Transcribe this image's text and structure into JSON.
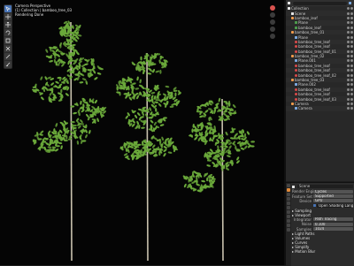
{
  "viewport": {
    "info_lines": [
      "Camera Perspective",
      "(1) Collection | bamboo_tree_03",
      "Rendering Done"
    ],
    "tools": [
      {
        "icon": "select-icon",
        "active": true
      },
      {
        "icon": "cursor-icon",
        "active": false
      },
      {
        "icon": "move-icon",
        "active": false
      },
      {
        "icon": "rotate-icon",
        "active": false
      },
      {
        "icon": "scale-icon",
        "active": false
      },
      {
        "icon": "transform-icon",
        "active": false
      },
      {
        "icon": "annotate-icon",
        "active": false
      },
      {
        "icon": "measure-icon",
        "active": false
      }
    ],
    "leaf_color": "#6aa83a",
    "stem_color": "#c9c2ae"
  },
  "outliner": {
    "rows": [
      {
        "label": "Collection",
        "indent": 0,
        "icon": "coll"
      },
      {
        "label": "Scene",
        "indent": 1,
        "icon": "coll"
      },
      {
        "label": "bamboo_leaf",
        "indent": 1,
        "icon": "obj"
      },
      {
        "label": "Plane",
        "indent": 2,
        "icon": "mesh"
      },
      {
        "label": "bamboo_leaf",
        "indent": 2,
        "icon": "mesh"
      },
      {
        "label": "bamboo_tree_01",
        "indent": 1,
        "icon": "obj"
      },
      {
        "label": "Plane",
        "indent": 2,
        "icon": "mod"
      },
      {
        "label": "bamboo_tree_leaf",
        "indent": 2,
        "icon": "part"
      },
      {
        "label": "bamboo_tree_leaf",
        "indent": 2,
        "icon": "part"
      },
      {
        "label": "bamboo_tree_leaf_01",
        "indent": 2,
        "icon": "part"
      },
      {
        "label": "bamboo_tree_02",
        "indent": 1,
        "icon": "obj"
      },
      {
        "label": "Plane.001",
        "indent": 2,
        "icon": "mod"
      },
      {
        "label": "bamboo_tree_leaf",
        "indent": 2,
        "icon": "part"
      },
      {
        "label": "bamboo_tree_leaf",
        "indent": 2,
        "icon": "part"
      },
      {
        "label": "bamboo_tree_leaf_02",
        "indent": 2,
        "icon": "part"
      },
      {
        "label": "bamboo_tree_03",
        "indent": 1,
        "icon": "obj"
      },
      {
        "label": "Plane.002",
        "indent": 2,
        "icon": "mod"
      },
      {
        "label": "bamboo_tree_leaf",
        "indent": 2,
        "icon": "part"
      },
      {
        "label": "bamboo_tree_leaf",
        "indent": 2,
        "icon": "part"
      },
      {
        "label": "bamboo_tree_leaf_03",
        "indent": 2,
        "icon": "part"
      },
      {
        "label": "Camera",
        "indent": 1,
        "icon": "obj"
      },
      {
        "label": "Camera",
        "indent": 2,
        "icon": "mod"
      }
    ]
  },
  "properties": {
    "object_name": "Scene",
    "rows": [
      {
        "label": "Render Engine",
        "value": "Cycles"
      },
      {
        "label": "Feature Set",
        "value": "Supported"
      },
      {
        "label": "Device",
        "value": "GPU"
      },
      {
        "label": "",
        "value": "Open Shading Language",
        "check": true
      }
    ],
    "sections": [
      {
        "label": "Sampling"
      },
      {
        "label": "Viewport",
        "rows": [
          {
            "label": "Integrator",
            "value": "Path Tracing"
          },
          {
            "label": "Noise",
            "value": "0.100"
          },
          {
            "label": "Samples",
            "value": "1024"
          }
        ]
      },
      {
        "label": "Light Paths"
      },
      {
        "label": "Volumes"
      },
      {
        "label": "Curves"
      },
      {
        "label": "Simplify"
      },
      {
        "label": "Motion Blur"
      }
    ]
  }
}
